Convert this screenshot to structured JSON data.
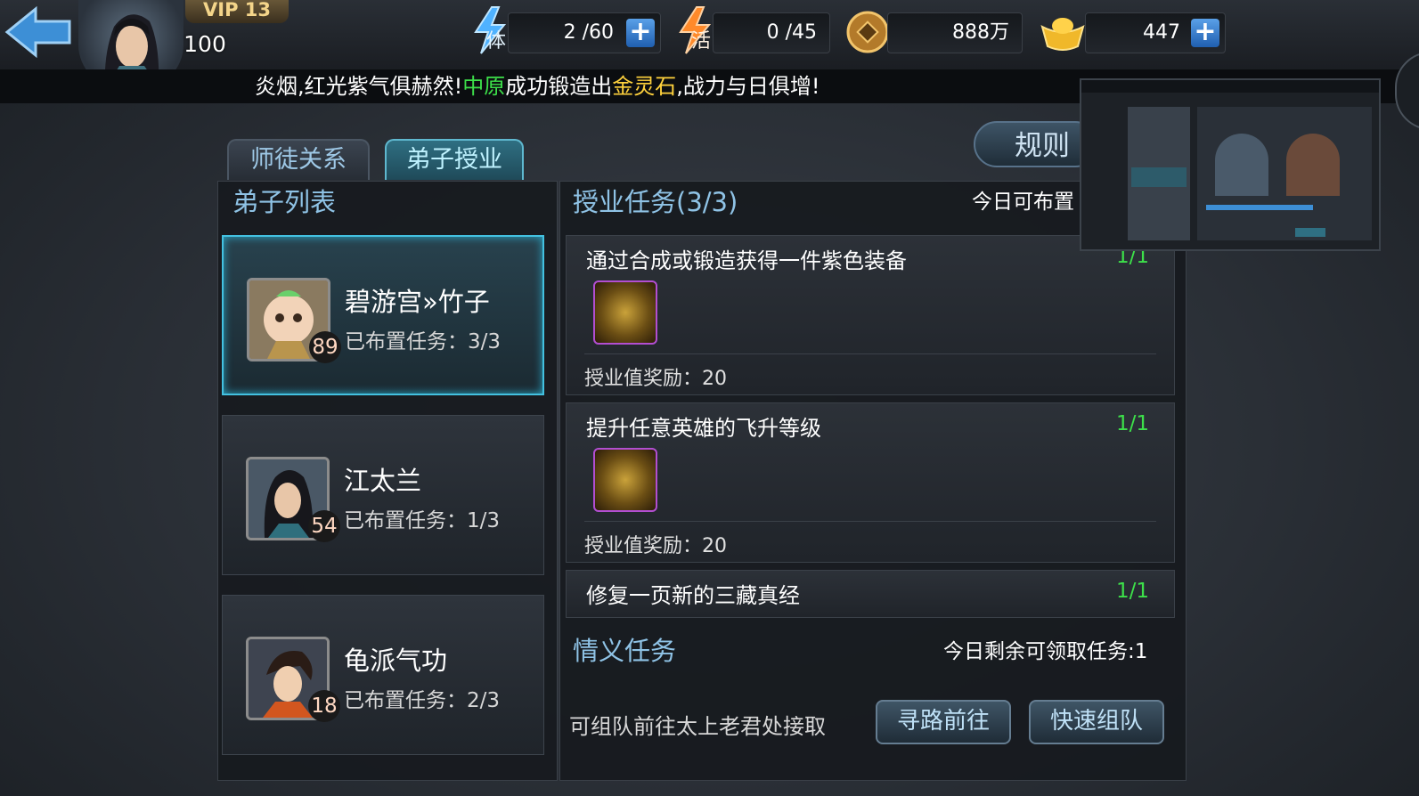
{
  "header": {
    "vip_label": "VIP 13",
    "player_level": "100",
    "stamina": {
      "icon_label": "体",
      "value": "2 /60"
    },
    "activity": {
      "icon_label": "活",
      "value": "0 /45"
    },
    "coins": {
      "value": "888万"
    },
    "gold": {
      "value": "447"
    },
    "plus_label": "+"
  },
  "marquee": {
    "part1": "炎烟,红光紫气俱赫然!",
    "highlight1": "中原",
    "part2": "成功锻造出",
    "highlight2": "金灵石",
    "part3": ",战力与日俱增!"
  },
  "tabs": [
    {
      "label": "师徒关系",
      "active": false
    },
    {
      "label": "弟子授业",
      "active": true
    }
  ],
  "rule_button": "规则",
  "disciples": {
    "title": "弟子列表",
    "items": [
      {
        "name": "碧游宫»竹子",
        "level": "89",
        "task_status": "已布置任务：3/3",
        "selected": true
      },
      {
        "name": "江太兰",
        "level": "54",
        "task_status": "已布置任务：1/3",
        "selected": false
      },
      {
        "name": "龟派气功",
        "level": "18",
        "task_status": "已布置任务：2/3",
        "selected": false
      }
    ]
  },
  "tasks": {
    "title": "授业任务(3/3)",
    "today_label": "今日可布置",
    "items": [
      {
        "name": "通过合成或锻造获得一件紫色装备",
        "progress": "1/1",
        "reward": "授业值奖励：20"
      },
      {
        "name": "提升任意英雄的飞升等级",
        "progress": "1/1",
        "reward": "授业值奖励：20"
      },
      {
        "name": "修复一页新的三藏真经",
        "progress": "1/1"
      }
    ]
  },
  "friendship": {
    "title": "情义任务",
    "remaining": "今日剩余可领取任务:1",
    "description": "可组队前往太上老君处接取",
    "btn_path": "寻路前往",
    "btn_team": "快速组队"
  },
  "colors": {
    "accent": "#43c1e0",
    "progress_green": "#3de04a",
    "gold_text": "#ffd23d",
    "title_blue": "#8fc3e6"
  }
}
